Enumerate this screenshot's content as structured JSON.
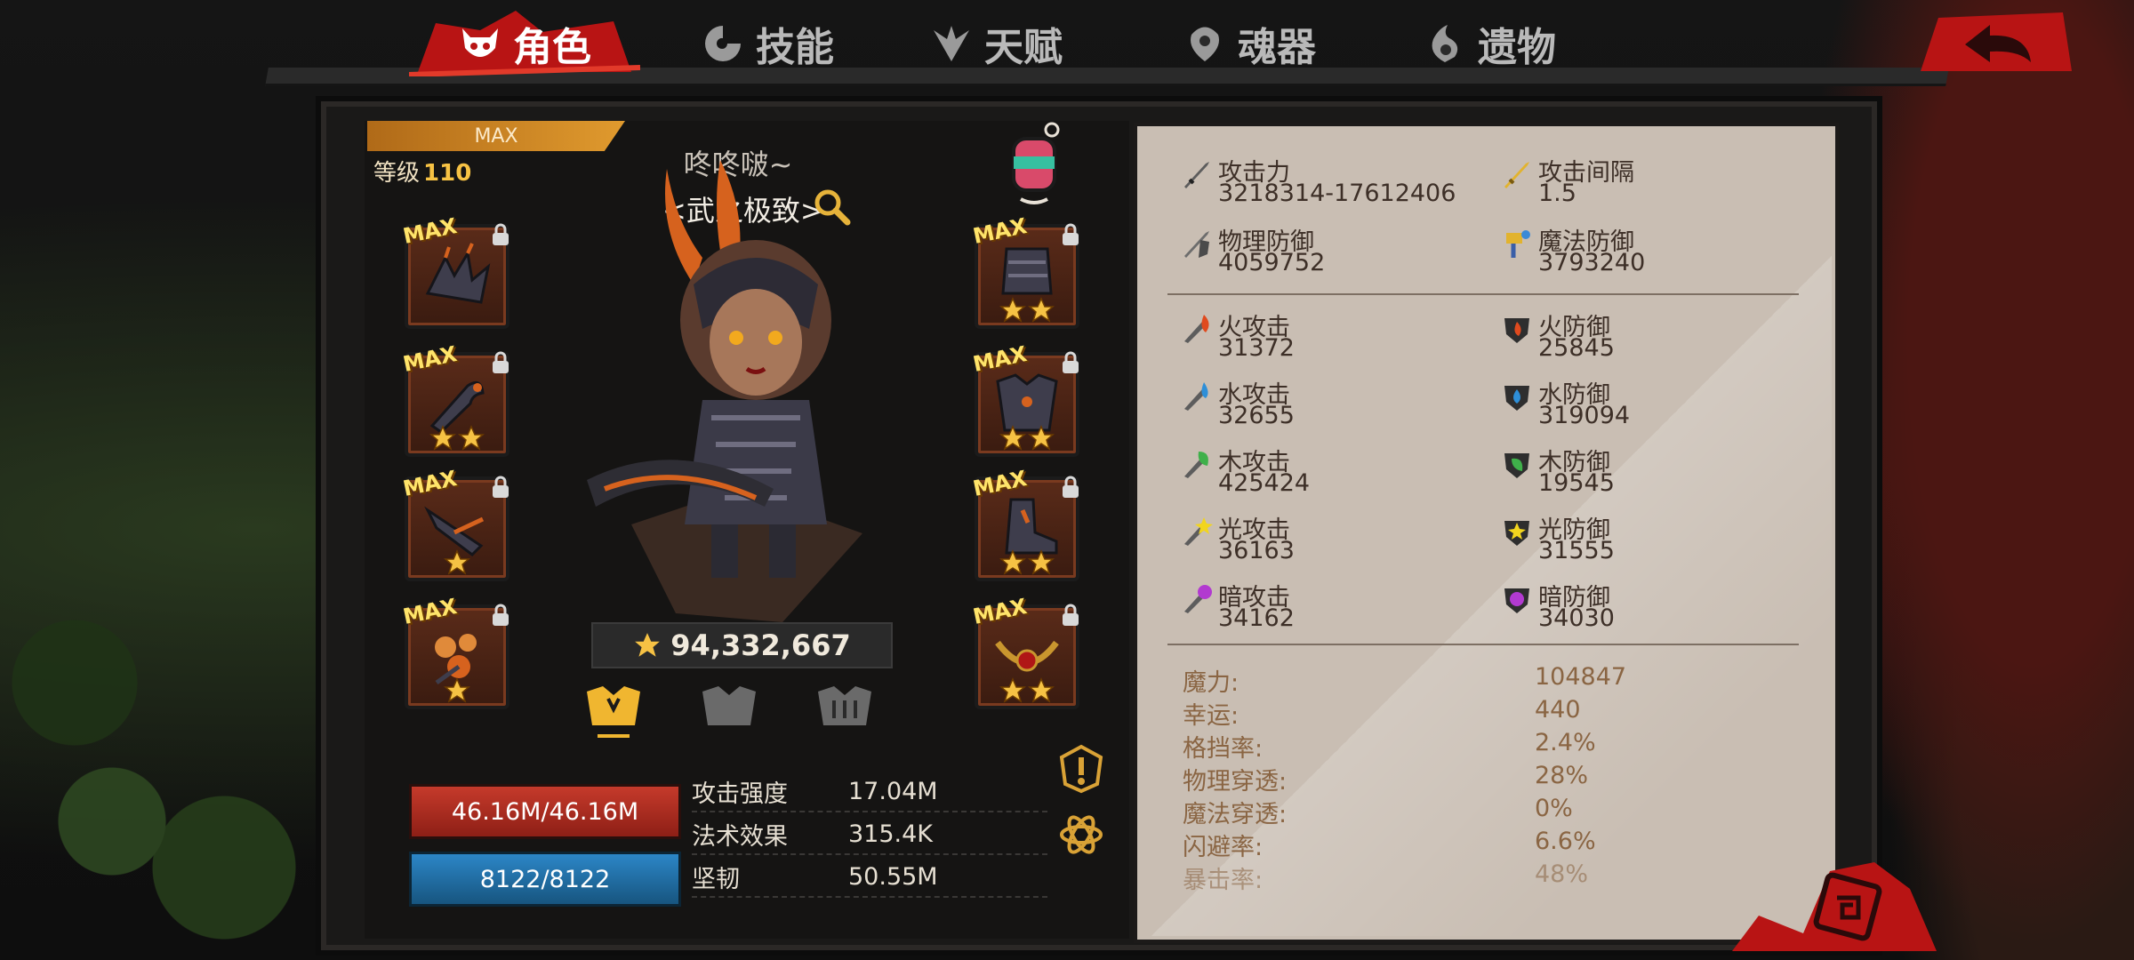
{
  "tabs": [
    {
      "label": "角色",
      "icon": "devil-face-icon",
      "active": true
    },
    {
      "label": "技能",
      "icon": "swirl-blade-icon",
      "active": false
    },
    {
      "label": "天赋",
      "icon": "wings-icon",
      "active": false
    },
    {
      "label": "魂器",
      "icon": "soul-drop-icon",
      "active": false
    },
    {
      "label": "遗物",
      "icon": "flame-swirl-icon",
      "active": false
    }
  ],
  "character": {
    "max_label": "MAX",
    "level_label": "等级",
    "level": "110",
    "name": "咚咚啵~",
    "title": "<武之极致>",
    "power": "94,332,667"
  },
  "equipment": {
    "left": [
      {
        "badge": "MAX",
        "stars": 0,
        "icon": "claw-gauntlet-icon"
      },
      {
        "badge": "MAX",
        "stars": 2,
        "icon": "serpent-staff-icon"
      },
      {
        "badge": "MAX",
        "stars": 1,
        "icon": "dark-blade-icon"
      },
      {
        "badge": "MAX",
        "stars": 1,
        "icon": "orb-cluster-icon"
      }
    ],
    "right": [
      {
        "badge": "MAX",
        "stars": 2,
        "icon": "chain-armor-icon"
      },
      {
        "badge": "MAX",
        "stars": 2,
        "icon": "chest-armor-icon"
      },
      {
        "badge": "MAX",
        "stars": 2,
        "icon": "boots-icon"
      },
      {
        "badge": "MAX",
        "stars": 2,
        "icon": "ruby-necklace-icon"
      }
    ]
  },
  "bars": {
    "hp": "46.16M/46.16M",
    "mp": "8122/8122"
  },
  "mini_stats": [
    {
      "label": "攻击强度",
      "value": "17.04M"
    },
    {
      "label": "法术效果",
      "value": "315.4K"
    },
    {
      "label": "坚韧",
      "value": "50.55M"
    }
  ],
  "stats_primary": [
    {
      "name": "攻击力",
      "value": "3218314-17612406",
      "icon": "sword-icon"
    },
    {
      "name": "攻击间隔",
      "value": "1.5",
      "icon": "golden-sword-icon"
    },
    {
      "name": "物理防御",
      "value": "4059752",
      "icon": "sword-shield-icon"
    },
    {
      "name": "魔法防御",
      "value": "3793240",
      "icon": "magic-hammer-icon"
    }
  ],
  "stats_elemental": [
    {
      "name": "火攻击",
      "value": "31372",
      "icon": "fire-attack-icon"
    },
    {
      "name": "火防御",
      "value": "25845",
      "icon": "fire-defense-icon"
    },
    {
      "name": "水攻击",
      "value": "32655",
      "icon": "water-attack-icon"
    },
    {
      "name": "水防御",
      "value": "319094",
      "icon": "water-defense-icon"
    },
    {
      "name": "木攻击",
      "value": "425424",
      "icon": "wood-attack-icon"
    },
    {
      "name": "木防御",
      "value": "19545",
      "icon": "wood-defense-icon"
    },
    {
      "name": "光攻击",
      "value": "36163",
      "icon": "light-attack-icon"
    },
    {
      "name": "光防御",
      "value": "31555",
      "icon": "light-defense-icon"
    },
    {
      "name": "暗攻击",
      "value": "34162",
      "icon": "dark-attack-icon"
    },
    {
      "name": "暗防御",
      "value": "34030",
      "icon": "dark-defense-icon"
    }
  ],
  "stats_misc": [
    {
      "k": "魔力:",
      "v": "104847"
    },
    {
      "k": "幸运:",
      "v": "440"
    },
    {
      "k": "格挡率:",
      "v": "2.4%"
    },
    {
      "k": "物理穿透:",
      "v": "28%"
    },
    {
      "k": "魔法穿透:",
      "v": "0%"
    },
    {
      "k": "闪避率:",
      "v": "6.6%"
    },
    {
      "k": "暴击率:",
      "v": "48%"
    }
  ],
  "colors": {
    "accent_red": "#d81e1e",
    "sheet_bg": "#c9beb3",
    "hp_red": "#c53a2b",
    "mp_blue": "#2c86c7",
    "gold": "#f6c244"
  }
}
